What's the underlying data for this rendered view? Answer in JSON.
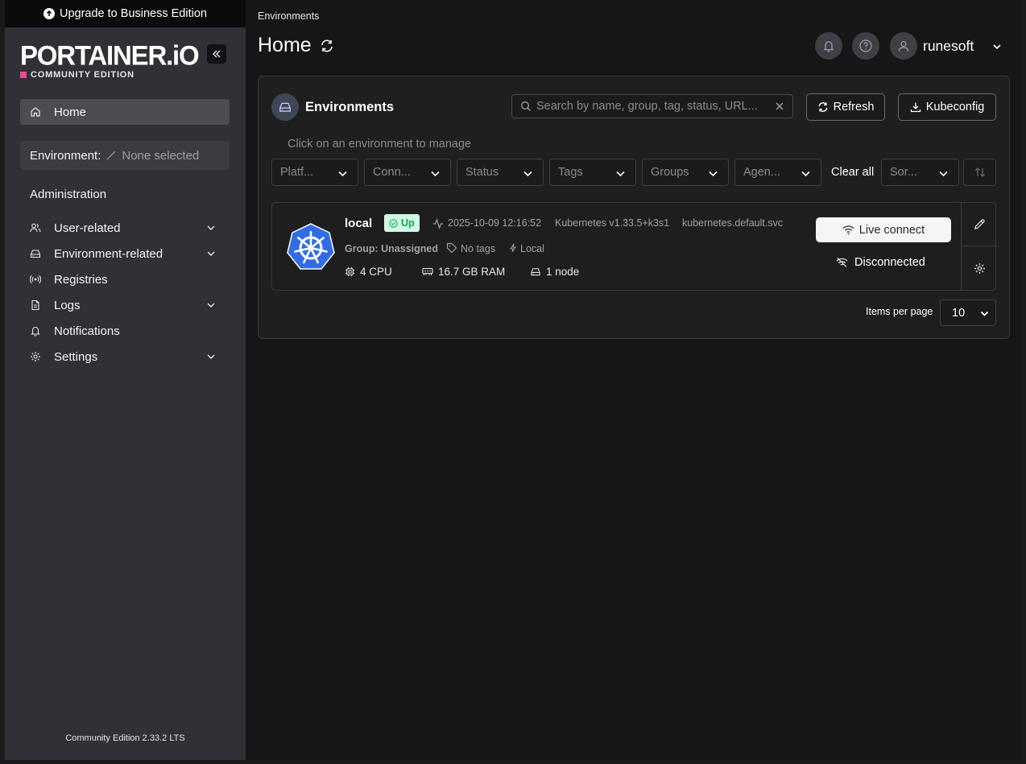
{
  "upgrade": {
    "label": "Upgrade to Business Edition"
  },
  "logo": {
    "name": "PORTAINER.iO",
    "edition": "COMMUNITY EDITION"
  },
  "sidebar": {
    "home": "Home",
    "environment_label": "Environment:",
    "environment_value": "None selected",
    "administration": "Administration",
    "items": [
      {
        "label": "User-related",
        "icon": "users-icon"
      },
      {
        "label": "Environment-related",
        "icon": "hard-drive-icon"
      },
      {
        "label": "Registries",
        "icon": "radio-icon"
      },
      {
        "label": "Logs",
        "icon": "file-text-icon"
      },
      {
        "label": "Notifications",
        "icon": "bell-icon"
      },
      {
        "label": "Settings",
        "icon": "gear-icon"
      }
    ],
    "version": "Community Edition  2.33.2 LTS"
  },
  "header": {
    "breadcrumb": "Environments",
    "title": "Home",
    "username": "runesoft"
  },
  "panel": {
    "title": "Environments",
    "search_placeholder": "Search by name, group, tag, status, URL...",
    "refresh": "Refresh",
    "kubeconfig": "Kubeconfig",
    "hint": "Click on an environment to manage",
    "filters": {
      "platform": "Platf...",
      "connection": "Conn...",
      "status": "Status",
      "tags": "Tags",
      "groups": "Groups",
      "agent": "Agen...",
      "clear_all": "Clear all",
      "sort": "Sor..."
    },
    "environment": {
      "name": "local",
      "status": "Up",
      "timestamp": "2025-10-09 12:16:52",
      "version": "Kubernetes v1.33.5+k3s1",
      "url": "kubernetes.default.svc",
      "group": "Group: Unassigned",
      "tags": "No tags",
      "type": "Local",
      "cpu": "4 CPU",
      "ram": "16.7 GB RAM",
      "nodes": "1 node",
      "live_connect": "Live connect",
      "connection_state": "Disconnected"
    },
    "items_per_page_label": "Items per page",
    "items_per_page_value": "10"
  },
  "colors": {
    "sidebar_bg": "#2f3136",
    "main_bg": "#161616",
    "status_up_bg": "#d1fae5",
    "status_up_fg": "#16a34a",
    "kubernetes_blue": "#326ce5",
    "logo_accent": "#ec4899"
  }
}
